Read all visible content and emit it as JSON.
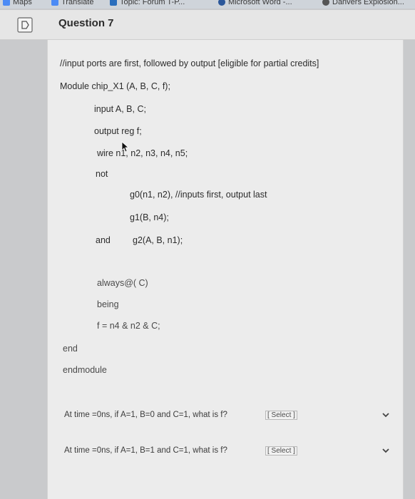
{
  "bookmarks": [
    {
      "label": "Maps",
      "icon": "maps-icon",
      "color": "#4c8bf5"
    },
    {
      "label": "Translate",
      "icon": "translate-icon",
      "color": "#4c8bf5"
    },
    {
      "label": "Topic: Forum T-P...",
      "icon": "forum-icon",
      "color": "#2a6ebc"
    },
    {
      "label": "Microsoft Word -...",
      "icon": "word-icon",
      "color": "#2b579a"
    },
    {
      "label": "Danvers Explosion...",
      "icon": "globe-icon",
      "color": "#555555"
    }
  ],
  "question": {
    "title": "Question 7",
    "flag_icon": "flag-icon"
  },
  "code": {
    "comment_header": "//input ports are first, followed by output [eligible for partial credits]",
    "module_decl": "Module chip_X1 (A, B, C, f);",
    "input_line": "input A, B, C;",
    "output_line": "output reg f;",
    "wire_line": "wire n1, n2, n3, n4, n5;",
    "not_kw": "not",
    "g0_line": "g0(n1, n2), //inputs first, output last",
    "g1_line": "g1(B, n4);",
    "and_kw": "and",
    "g2_line": "g2(A, B, n1);",
    "always_line": "always@( C)",
    "being_line": "being",
    "assign_line": "f = n4 & n2 & C;",
    "end_line": "end",
    "endmodule_line": "endmodule"
  },
  "questions": [
    {
      "text": "At time =0ns, if A=1, B=0 and C=1, what is f?",
      "select": "[ Select ]"
    },
    {
      "text": "At time =0ns, if A=1, B=1 and C=1, what is f?",
      "select": "[ Select ]"
    }
  ],
  "colors": {
    "card_bg": "#ececec",
    "page_bg": "#c9cacc",
    "text": "#2c2c2c"
  }
}
